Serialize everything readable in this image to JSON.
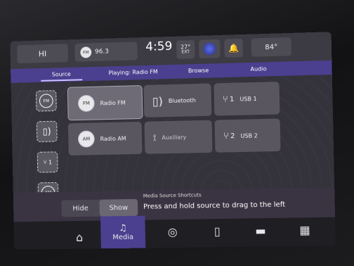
{
  "status": {
    "profile_label": "HI",
    "radio_badge": "FM",
    "radio_freq": "96.3",
    "time": "4:59",
    "ext_temp": "27°",
    "ext_label": "EXT",
    "cabin_temp": "84°"
  },
  "tabs": {
    "source": "Source",
    "now_playing": "Playing: Radio FM",
    "browse": "Browse",
    "audio": "Audio"
  },
  "sidebar": {
    "fm": "FM",
    "usb": "1",
    "am": "AM"
  },
  "tiles": {
    "radio_fm": "Radio FM",
    "radio_fm_badge": "FM",
    "bluetooth": "Bluetooth",
    "usb1": "USB 1",
    "usb1_num": "1",
    "radio_am": "Radio AM",
    "radio_am_badge": "AM",
    "auxiliary": "Auxiliary",
    "usb2": "USB 2",
    "usb2_num": "2"
  },
  "hint": {
    "hide": "Hide",
    "show": "Show",
    "title": "Media Source Shortcuts",
    "message": "Press and hold source to drag to the left"
  },
  "nav": {
    "media": "Media"
  }
}
